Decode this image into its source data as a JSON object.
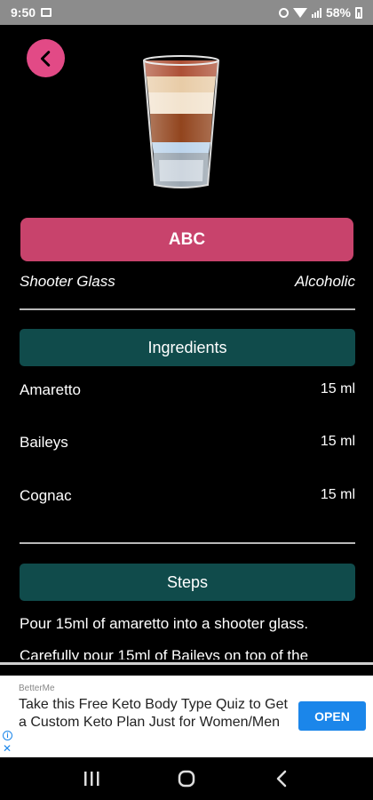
{
  "status_bar": {
    "time": "9:50",
    "battery": "58%"
  },
  "header": {
    "back_icon": "chevron-left-icon"
  },
  "drink": {
    "title": "ABC",
    "glass": "Shooter Glass",
    "category": "Alcoholic"
  },
  "ingredients": {
    "header": "Ingredients",
    "items": [
      {
        "name": "Amaretto",
        "amount": "15 ml"
      },
      {
        "name": "Baileys",
        "amount": "15 ml"
      },
      {
        "name": "Cognac",
        "amount": "15 ml"
      }
    ]
  },
  "steps": {
    "header": "Steps",
    "items": [
      "Pour 15ml of amaretto into a shooter glass.",
      "Carefully pour 15ml of Baileys on top of the"
    ]
  },
  "ad": {
    "source": "BetterMe",
    "text": "Take this Free Keto Body Type Quiz to Get a Custom Keto Plan Just for Women/Men",
    "cta": "OPEN"
  },
  "colors": {
    "accent_pink": "#e24a86",
    "title_button": "#c8436c",
    "section_teal": "#104b4b",
    "ad_button_blue": "#1b86ea"
  }
}
